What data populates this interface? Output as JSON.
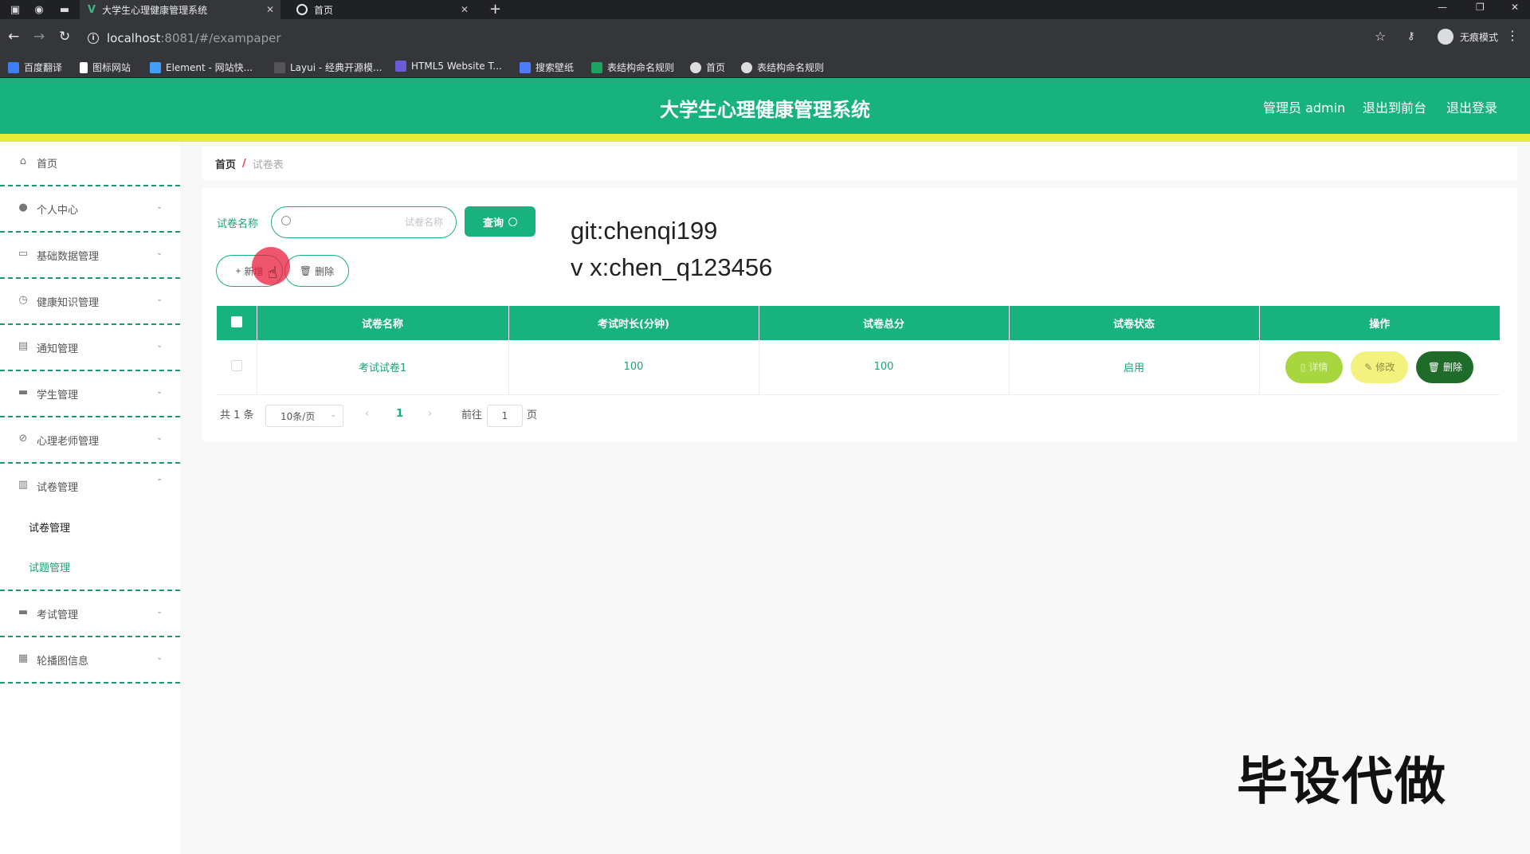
{
  "browser": {
    "tabs": [
      {
        "title": "大学生心理健康管理系统",
        "active": true
      },
      {
        "title": "首页",
        "active": false
      }
    ],
    "url_host": "localhost",
    "url_path": ":8081/#/exampaper",
    "profile_label": "无痕模式",
    "bookmarks": [
      "百度翻译",
      "图标网站",
      "Element - 网站快...",
      "Layui - 经典开源模...",
      "HTML5 Website T...",
      "搜索壁纸",
      "表结构命名规则",
      "首页",
      "表结构命名规则"
    ]
  },
  "header": {
    "title": "大学生心理健康管理系统",
    "admin": "管理员 admin",
    "back_front": "退出到前台",
    "logout": "退出登录"
  },
  "sidebar": {
    "items": [
      {
        "label": "首页",
        "icon": "home-icon"
      },
      {
        "label": "个人中心",
        "icon": "user-icon"
      },
      {
        "label": "基础数据管理",
        "icon": "chat-icon"
      },
      {
        "label": "健康知识管理",
        "icon": "clock-icon"
      },
      {
        "label": "通知管理",
        "icon": "briefcase-icon"
      },
      {
        "label": "学生管理",
        "icon": "message-icon"
      },
      {
        "label": "心理老师管理",
        "icon": "bell-off-icon"
      },
      {
        "label": "试卷管理",
        "icon": "clipboard-icon"
      },
      {
        "label": "考试管理",
        "icon": "monitor-icon"
      },
      {
        "label": "轮播图信息",
        "icon": "grid-icon"
      }
    ],
    "submenu": [
      {
        "label": "试卷管理",
        "active": true
      },
      {
        "label": "试题管理",
        "active": false
      }
    ]
  },
  "breadcrumb": {
    "home": "首页",
    "separator": "/",
    "current": "试卷表"
  },
  "search": {
    "label": "试卷名称",
    "placeholder": "试卷名称",
    "query_button": "查询"
  },
  "actions": {
    "add": "新增",
    "delete": "删除"
  },
  "watermark": {
    "line1": "git:chenqi199",
    "line2": "v x:chen_q123456",
    "big": "毕设代做"
  },
  "table": {
    "headers": [
      "试卷名称",
      "考试时长(分钟)",
      "试卷总分",
      "试卷状态",
      "操作"
    ],
    "rows": [
      {
        "name": "考试试卷1",
        "duration": "100",
        "score": "100",
        "status": "启用"
      }
    ],
    "row_actions": {
      "detail": "详情",
      "edit": "修改",
      "delete": "删除"
    }
  },
  "pagination": {
    "total": "共 1 条",
    "page_size": "10条/页",
    "current": "1",
    "goto_label": "前往",
    "goto_value": "1",
    "page_suffix": "页"
  },
  "colors": {
    "primary": "#17b27e",
    "accent_bar": "#e6ee3a",
    "detail": "#a7d63f",
    "edit": "#f4f27e",
    "delete": "#1f6b2a"
  }
}
